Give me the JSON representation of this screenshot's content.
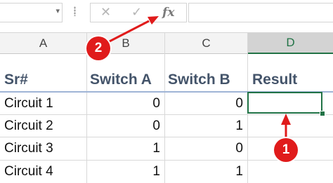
{
  "formula_bar": {
    "name_box_value": "",
    "cancel_icon": "✕",
    "enter_icon": "✓",
    "function_label": "fx",
    "formula_value": ""
  },
  "column_headers": [
    "A",
    "B",
    "C",
    "D"
  ],
  "sheet": {
    "headers": [
      "Sr#",
      "Switch A",
      "Switch B",
      "Result"
    ],
    "rows": [
      {
        "sr": "Circuit 1",
        "a": "0",
        "b": "0",
        "result": ""
      },
      {
        "sr": "Circuit 2",
        "a": "0",
        "b": "1",
        "result": ""
      },
      {
        "sr": "Circuit 3",
        "a": "1",
        "b": "0",
        "result": ""
      },
      {
        "sr": "Circuit 4",
        "a": "1",
        "b": "1",
        "result": ""
      }
    ]
  },
  "annotations": {
    "badge_1": "1",
    "badge_2": "2",
    "color": "#e01b1b"
  },
  "colors": {
    "accent": "#217346",
    "header_text": "#44546a"
  }
}
